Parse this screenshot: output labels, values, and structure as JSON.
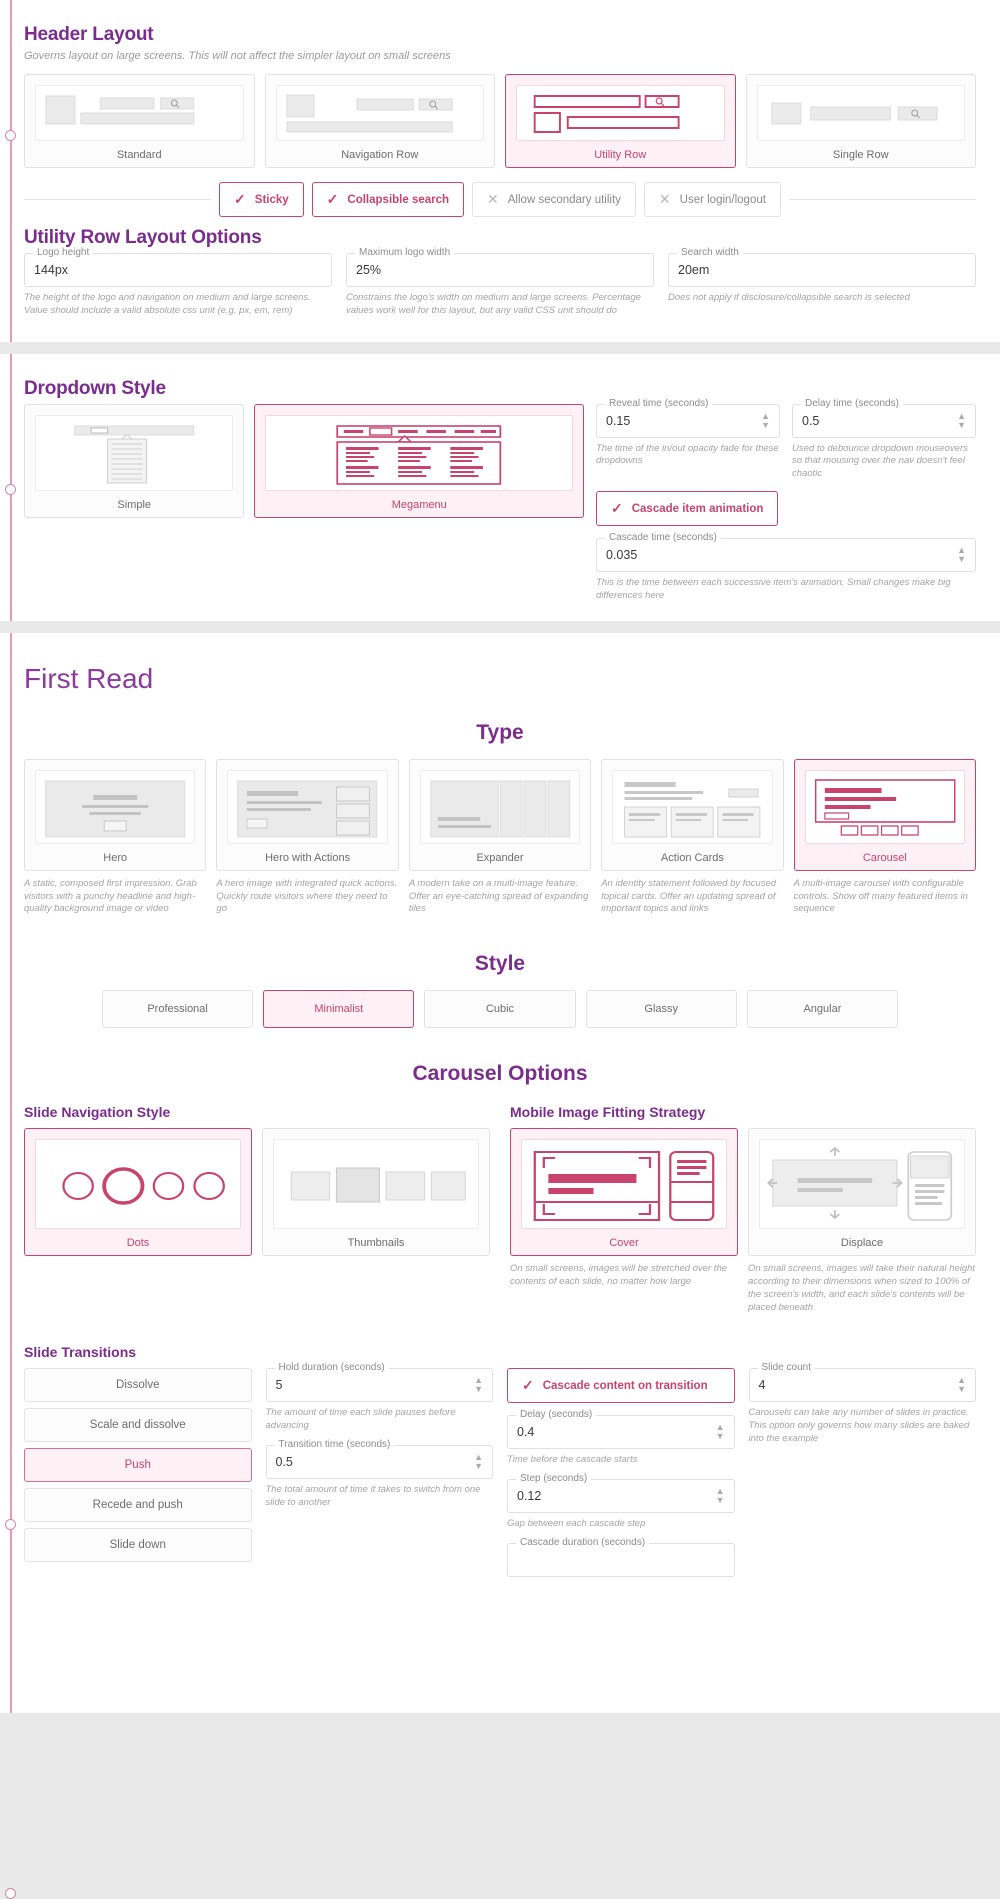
{
  "header_layout": {
    "title": "Header Layout",
    "description": "Governs layout on large screens. This will not affect the simpler layout on small screens",
    "options": [
      {
        "label": "Standard",
        "selected": false
      },
      {
        "label": "Navigation Row",
        "selected": false
      },
      {
        "label": "Utility Row",
        "selected": true
      },
      {
        "label": "Single Row",
        "selected": false
      }
    ],
    "toggles": [
      {
        "label": "Sticky",
        "on": true,
        "icon": "check-icon"
      },
      {
        "label": "Collapsible search",
        "on": true,
        "icon": "check-icon"
      },
      {
        "label": "Allow secondary utility",
        "on": false,
        "icon": "close-icon"
      },
      {
        "label": "User login/logout",
        "on": false,
        "icon": "close-icon"
      }
    ]
  },
  "utility_row_options": {
    "title": "Utility Row Layout Options",
    "fields": [
      {
        "legend": "Logo height",
        "value": "144px",
        "description": "The height of the logo and navigation on medium and large screens. Value should include a valid absolute css unit (e.g. px, em, rem)"
      },
      {
        "legend": "Maximum logo width",
        "value": "25%",
        "description": "Constrains the logo's width on medium and large screens. Percentage values work well for this layout, but any valid CSS unit should do"
      },
      {
        "legend": "Search width",
        "value": "20em",
        "description": "Does not apply if disclosure/collapsible search is selected"
      }
    ]
  },
  "dropdown_style": {
    "title": "Dropdown Style",
    "options": [
      {
        "label": "Simple",
        "selected": false
      },
      {
        "label": "Megamenu",
        "selected": true
      }
    ],
    "reveal": {
      "legend": "Reveal time (seconds)",
      "value": "0.15",
      "description": "The time of the in/out opacity fade for these dropdowns"
    },
    "delay": {
      "legend": "Delay time (seconds)",
      "value": "0.5",
      "description": "Used to debounce dropdown mouseovers so that mousing over the nav doesn't feel chaotic"
    },
    "cascade_toggle": {
      "label": "Cascade item animation",
      "on": true,
      "icon": "check-icon"
    },
    "cascade_time": {
      "legend": "Cascade time (seconds)",
      "value": "0.035",
      "description": "This is the time between each successive item's animation. Small changes make big differences here"
    }
  },
  "first_read": {
    "title": "First Read",
    "type_heading": "Type",
    "types": [
      {
        "label": "Hero",
        "selected": false,
        "description": "A static, composed first impression. Grab visitors with a punchy headline and high-quality background image or video"
      },
      {
        "label": "Hero with Actions",
        "selected": false,
        "description": "A hero image with integrated quick actions. Quickly route visitors where they need to go"
      },
      {
        "label": "Expander",
        "selected": false,
        "description": "A modern take on a multi-image feature. Offer an eye-catching spread of expanding tiles"
      },
      {
        "label": "Action Cards",
        "selected": false,
        "description": "An identity statement followed by focused topical cards. Offer an updating spread of important topics and links"
      },
      {
        "label": "Carousel",
        "selected": true,
        "description": "A multi-image carousel with configurable controls. Show off many featured items in sequence"
      }
    ],
    "style_heading": "Style",
    "styles": [
      {
        "label": "Professional",
        "selected": false
      },
      {
        "label": "Minimalist",
        "selected": true
      },
      {
        "label": "Cubic",
        "selected": false
      },
      {
        "label": "Glassy",
        "selected": false
      },
      {
        "label": "Angular",
        "selected": false
      }
    ]
  },
  "carousel_options": {
    "heading": "Carousel Options",
    "slide_nav": {
      "title": "Slide Navigation Style",
      "options": [
        {
          "label": "Dots",
          "selected": true
        },
        {
          "label": "Thumbnails",
          "selected": false
        }
      ]
    },
    "mobile_fit": {
      "title": "Mobile Image Fitting Strategy",
      "options": [
        {
          "label": "Cover",
          "selected": true,
          "description": "On small screens, images will be stretched over the contents of each slide, no matter how large"
        },
        {
          "label": "Displace",
          "selected": false,
          "description": "On small screens, images will take their natural height according to their dimensions when sized to 100% of the screen's width, and each slide's contents will be placed beneath"
        }
      ]
    },
    "slide_transitions": {
      "title": "Slide Transitions",
      "items": [
        {
          "label": "Dissolve",
          "selected": false
        },
        {
          "label": "Scale and dissolve",
          "selected": false
        },
        {
          "label": "Push",
          "selected": true
        },
        {
          "label": "Recede and push",
          "selected": false
        },
        {
          "label": "Slide down",
          "selected": false
        }
      ]
    },
    "hold": {
      "legend": "Hold duration (seconds)",
      "value": "5",
      "description": "The amount of time each slide pauses before advancing"
    },
    "transition_time": {
      "legend": "Transition time (seconds)",
      "value": "0.5",
      "description": "The total amount of time it takes to switch from one slide to another"
    },
    "cascade_toggle": {
      "label": "Cascade content on transition",
      "on": true,
      "icon": "check-icon"
    },
    "cascade_delay": {
      "legend": "Delay (seconds)",
      "value": "0.4",
      "description": "Time before the cascade starts"
    },
    "cascade_step": {
      "legend": "Step (seconds)",
      "value": "0.12",
      "description": "Gap between each cascade step"
    },
    "cascade_duration": {
      "legend": "Cascade duration (seconds)",
      "value": "",
      "description": ""
    },
    "slide_count": {
      "legend": "Slide count",
      "value": "4",
      "description": "Carousels can take any number of slides in practice. This option only governs how many slides are baked into the example"
    }
  },
  "colors": {
    "accent": "#c9446c",
    "heading": "#7b2d8e",
    "muted": "#a3a3a3"
  }
}
